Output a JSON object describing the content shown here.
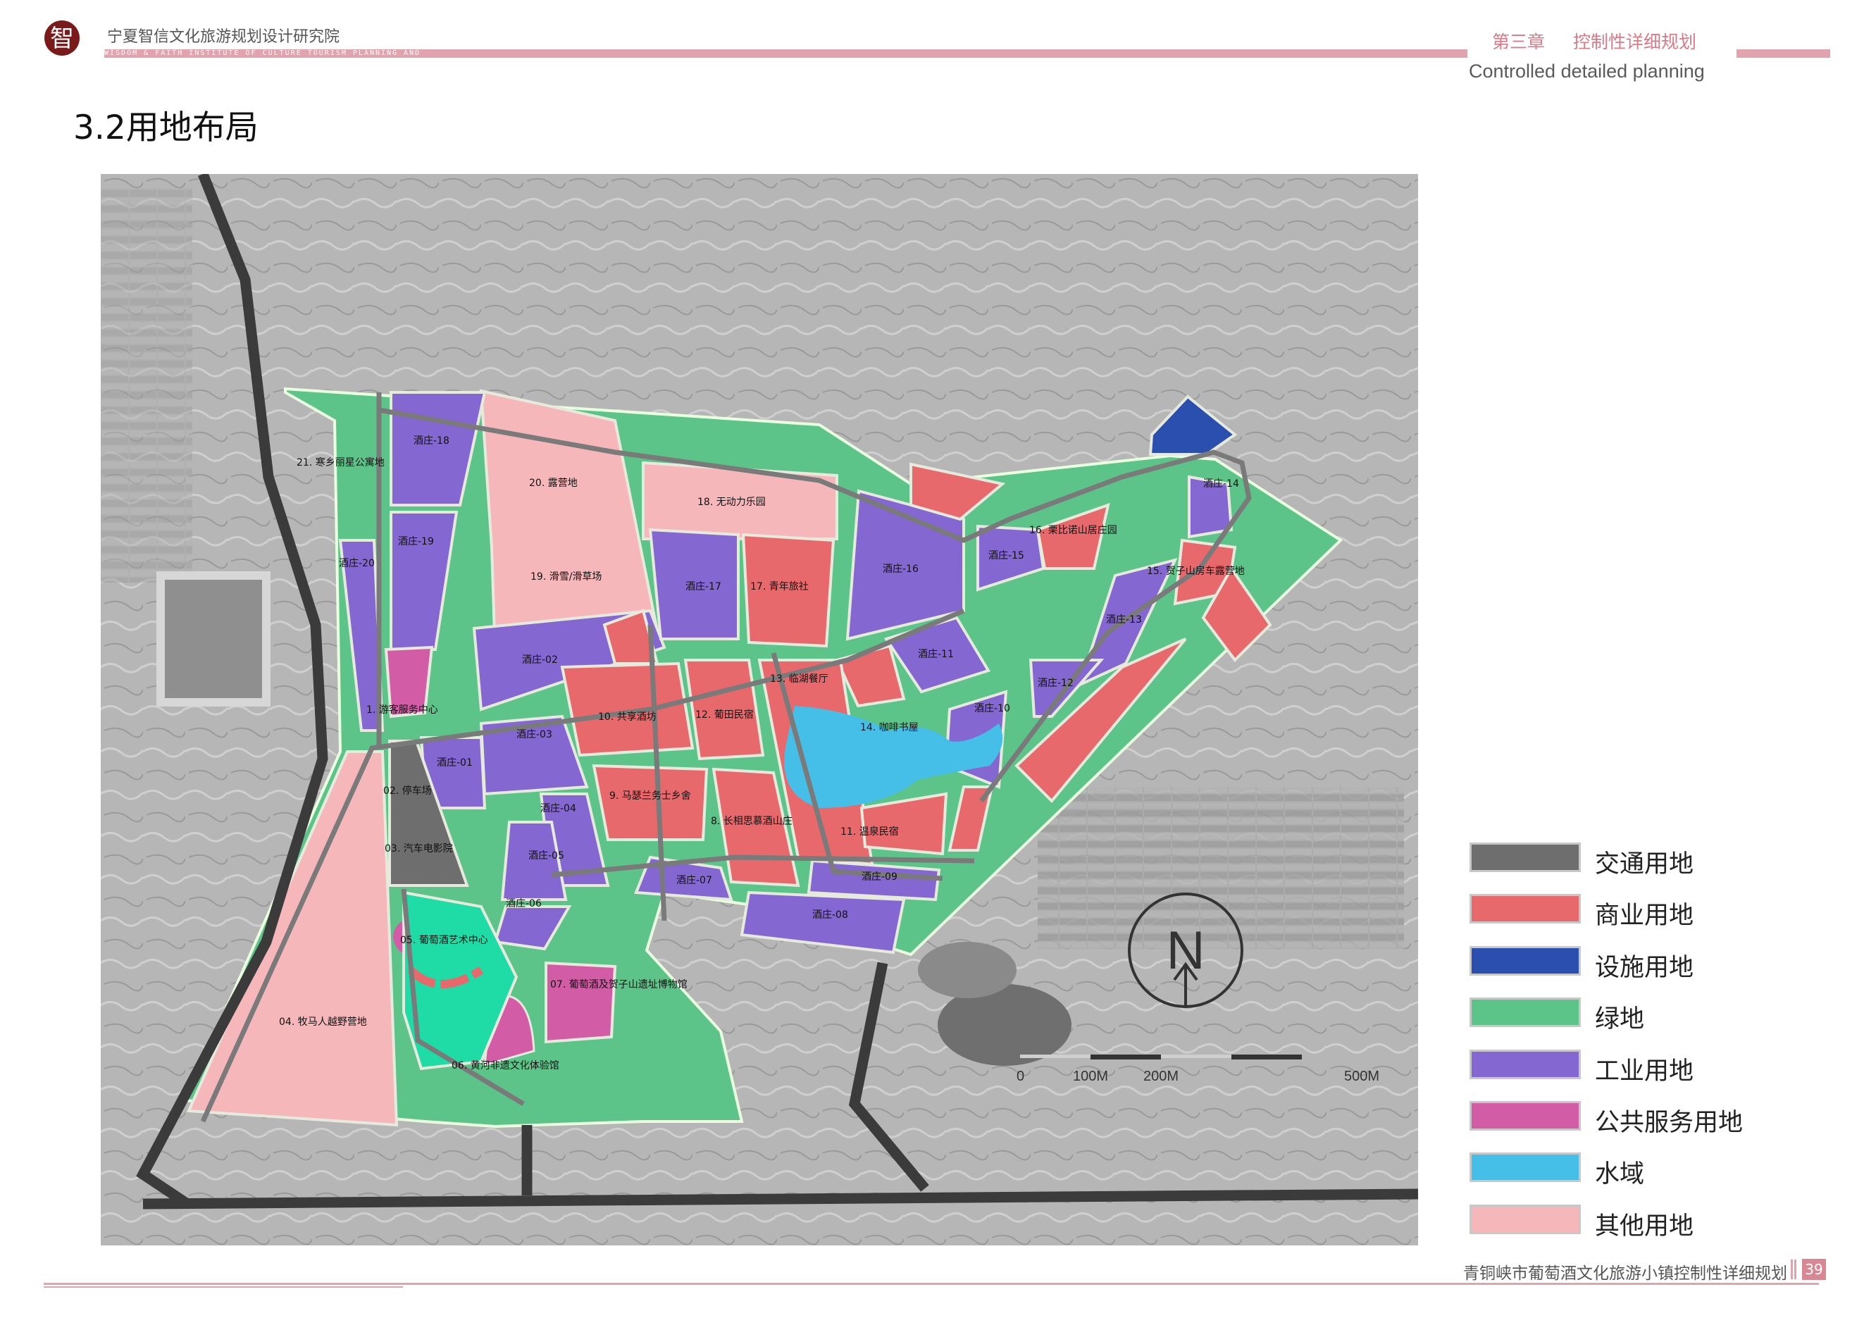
{
  "header": {
    "org_cn": "宁夏智信文化旅游规划设计研究院",
    "org_en": "WISDOM & FAITH INSTITUTE OF CULTURE TOURISM PLANNING AND",
    "chapter_num": "第三章",
    "chapter_title": "控制性详细规划",
    "chapter_en": "Controlled detailed planning",
    "logo_char": "智"
  },
  "page_title": "3.2用地布局",
  "colors": {
    "traffic": "#6e6e6e",
    "commercial": "#e8696c",
    "facility": "#2b4fae",
    "green": "#5cc389",
    "industrial": "#8467d0",
    "public": "#d25ca6",
    "water": "#46bfe8",
    "other": "#f6b7ba",
    "accent": "#e1a3ad"
  },
  "legend": [
    {
      "label": "交通用地",
      "color": "#6e6e6e"
    },
    {
      "label": "商业用地",
      "color": "#e8696c"
    },
    {
      "label": "设施用地",
      "color": "#2b4fae"
    },
    {
      "label": "绿地",
      "color": "#5cc389"
    },
    {
      "label": "工业用地",
      "color": "#8467d0"
    },
    {
      "label": "公共服务用地",
      "color": "#d25ca6"
    },
    {
      "label": "水域",
      "color": "#46bfe8"
    },
    {
      "label": "其他用地",
      "color": "#f6b7ba"
    }
  ],
  "map": {
    "north": "N",
    "scale": {
      "s0": "0",
      "s100": "100M",
      "s200": "200M",
      "s500": "500M"
    },
    "labels": {
      "l21": "21. 寒乡丽星公寓地",
      "l18a": "酒庄-18",
      "l19a": "酒庄-19",
      "l20a": "酒庄-20",
      "l20": "20. 露营地",
      "l19": "19. 滑雪/滑草场",
      "l18": "18. 无动力乐园",
      "l17a": "酒庄-17",
      "l17": "17. 青年旅社",
      "l16a": "酒庄-16",
      "l16": "16. 栗比诺山居庄园",
      "l15a": "酒庄-15",
      "l14a": "酒庄-14",
      "l15": "15. 贺子山房车露营地",
      "l13a": "酒庄-13",
      "l12a": "酒庄-12",
      "l11a": "酒庄-11",
      "l13": "13. 临湖餐厅",
      "l14": "14. 咖啡书屋",
      "l10a": "酒庄-10",
      "l12": "12. 葡田民宿",
      "l10": "10. 共享酒坊",
      "l02a": "酒庄-02",
      "l01": "1. 游客服务中心",
      "l03a": "酒庄-03",
      "l01a": "酒庄-01",
      "l02": "02. 停车场",
      "l9": "9. 马瑟兰务士乡舍",
      "l8": "8. 长相思慕酒山庄",
      "l11": "11. 温泉民宿",
      "l04a": "酒庄-04",
      "l03": "03. 汽车电影院",
      "l05a": "酒庄-05",
      "l06a": "酒庄-06",
      "l07a": "酒庄-07",
      "l08a": "酒庄-08",
      "l09a": "酒庄-09",
      "l05": "05. 葡萄酒艺术中心",
      "l07": "07. 葡萄酒及贺子山遗址博物馆",
      "l04": "04. 牧马人越野营地",
      "l06": "06. 黄河非遗文化体验馆"
    }
  },
  "footer": {
    "text": "青铜峡市葡萄酒文化旅游小镇控制性详细规划",
    "page": "39"
  }
}
